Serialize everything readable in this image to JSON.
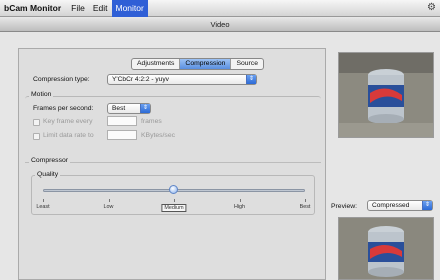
{
  "menubar": {
    "app_name": "bCam Monitor",
    "menus": [
      "File",
      "Edit",
      "Monitor"
    ]
  },
  "window": {
    "title": "Video"
  },
  "tabs": [
    "Adjustments",
    "Compression",
    "Source"
  ],
  "compression": {
    "type_label": "Compression type:",
    "type_value": "Y'CbCr 4:2:2 - yuyv"
  },
  "motion": {
    "title": "Motion",
    "fps_label": "Frames per second:",
    "fps_value": "Best",
    "keyframe_label": "Key frame every",
    "keyframe_unit": "frames",
    "keyframe_value": "",
    "limit_label": "Limit data rate to",
    "limit_unit": "KBytes/sec",
    "limit_value": ""
  },
  "compressor": {
    "title": "Compressor",
    "quality_label": "Quality",
    "quality_ticks": [
      "Least",
      "Low",
      "Medium",
      "High",
      "Best"
    ],
    "quality_selected": "Medium",
    "quality_fraction": 0.5
  },
  "preview": {
    "label": "Preview:",
    "mode": "Compressed"
  },
  "colors": {
    "accent": "#2f5fd6",
    "can_blue": "#2a4f9a",
    "can_silver": "#c7cfd6"
  },
  "icons": [
    "spinner-icon",
    "popup-arrows-icon"
  ]
}
